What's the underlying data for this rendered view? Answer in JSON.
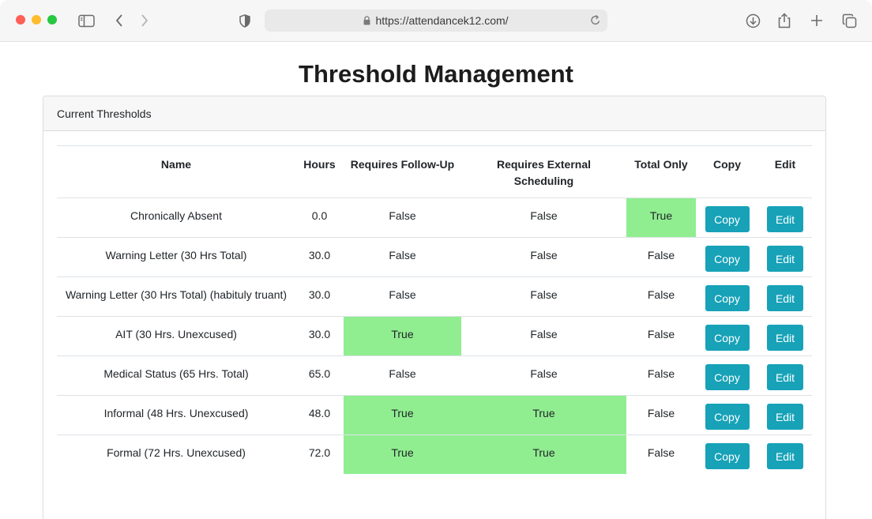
{
  "browser": {
    "url": "https://attendancek12.com/"
  },
  "page": {
    "title": "Threshold Management"
  },
  "card": {
    "header": "Current Thresholds"
  },
  "table": {
    "columns": [
      "Name",
      "Hours",
      "Requires Follow-Up",
      "Requires External Scheduling",
      "Total Only",
      "Copy",
      "Edit"
    ],
    "rows": [
      {
        "name": "Chronically Absent",
        "hours": "0.0",
        "follow_up": "False",
        "external": "False",
        "total_only": "True",
        "copy": "Copy",
        "edit": "Edit"
      },
      {
        "name": "Warning Letter (30 Hrs Total)",
        "hours": "30.0",
        "follow_up": "False",
        "external": "False",
        "total_only": "False",
        "copy": "Copy",
        "edit": "Edit"
      },
      {
        "name": "Warning Letter (30 Hrs Total) (habituly truant)",
        "hours": "30.0",
        "follow_up": "False",
        "external": "False",
        "total_only": "False",
        "copy": "Copy",
        "edit": "Edit"
      },
      {
        "name": "AIT (30 Hrs. Unexcused)",
        "hours": "30.0",
        "follow_up": "True",
        "external": "False",
        "total_only": "False",
        "copy": "Copy",
        "edit": "Edit"
      },
      {
        "name": "Medical Status (65 Hrs. Total)",
        "hours": "65.0",
        "follow_up": "False",
        "external": "False",
        "total_only": "False",
        "copy": "Copy",
        "edit": "Edit"
      },
      {
        "name": "Informal (48 Hrs. Unexcused)",
        "hours": "48.0",
        "follow_up": "True",
        "external": "True",
        "total_only": "False",
        "copy": "Copy",
        "edit": "Edit"
      },
      {
        "name": "Formal (72 Hrs. Unexcused)",
        "hours": "72.0",
        "follow_up": "True",
        "external": "True",
        "total_only": "False",
        "copy": "Copy",
        "edit": "Edit"
      }
    ]
  },
  "colors": {
    "true_highlight": "#90ee90",
    "button": "#17a2b8"
  }
}
